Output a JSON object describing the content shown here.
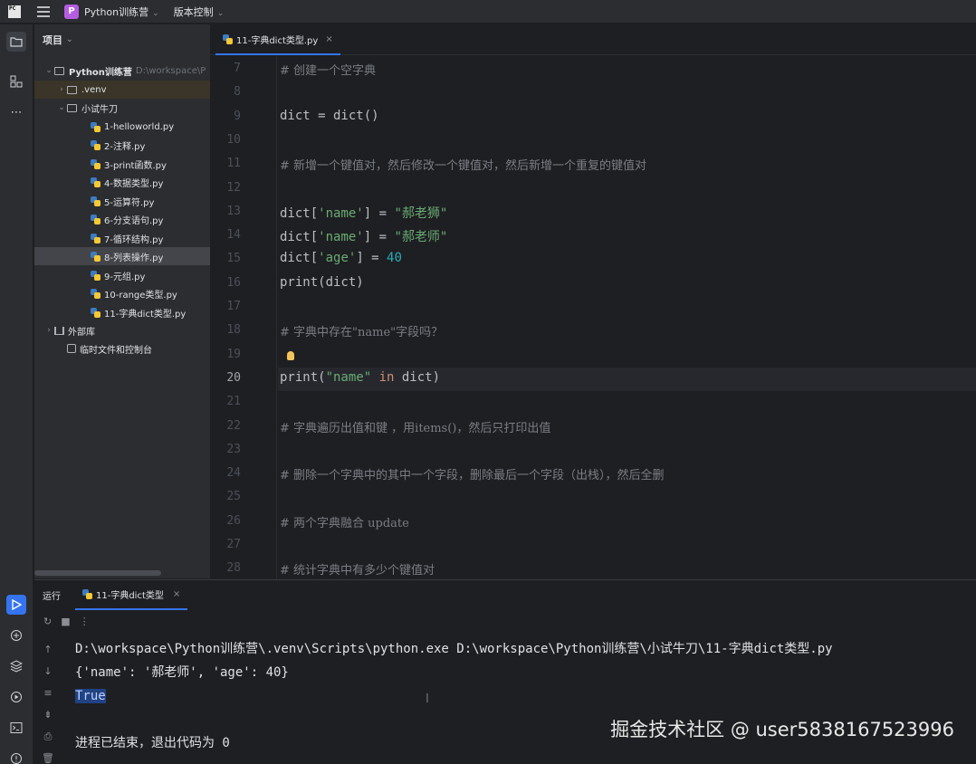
{
  "titlebar": {
    "logo": "PC",
    "project_badge": "P",
    "project_name": "Python训练营",
    "vcs": "版本控制"
  },
  "project_panel": {
    "header": "项目",
    "tree": [
      {
        "label": "Python训练营",
        "suffix": "D:\\workspace\\P",
        "icon": "folder-icon",
        "arrow": "⌄"
      },
      {
        "label": ".venv",
        "icon": "folder-icon",
        "arrow": "›"
      },
      {
        "label": "小试牛刀",
        "icon": "folder-icon",
        "arrow": "⌄"
      },
      {
        "label": "1-helloworld.py",
        "icon": "python-file-icon"
      },
      {
        "label": "2-注释.py",
        "icon": "python-file-icon"
      },
      {
        "label": "3-print函数.py",
        "icon": "python-file-icon"
      },
      {
        "label": "4-数据类型.py",
        "icon": "python-file-icon"
      },
      {
        "label": "5-运算符.py",
        "icon": "python-file-icon"
      },
      {
        "label": "6-分支语句.py",
        "icon": "python-file-icon"
      },
      {
        "label": "7-循环结构.py",
        "icon": "python-file-icon"
      },
      {
        "label": "8-列表操作.py",
        "icon": "python-file-icon"
      },
      {
        "label": "9-元组.py",
        "icon": "python-file-icon"
      },
      {
        "label": "10-range类型.py",
        "icon": "python-file-icon"
      },
      {
        "label": "11-字典dict类型.py",
        "icon": "python-file-icon"
      },
      {
        "label": "外部库",
        "icon": "library-icon",
        "arrow": "›"
      },
      {
        "label": "临时文件和控制台",
        "icon": "scratch-icon"
      }
    ]
  },
  "editor": {
    "tab": "11-字典dict类型.py",
    "current_line": "20",
    "lines": [
      {
        "n": "7",
        "code": "# 创建一个空字典"
      },
      {
        "n": "8",
        "code": ""
      },
      {
        "n": "9",
        "code": "dict = dict()"
      },
      {
        "n": "10",
        "code": ""
      },
      {
        "n": "11",
        "code": "# 新增一个键值对，然后修改一个键值对，然后新增一个重复的键值对"
      },
      {
        "n": "12",
        "code": ""
      },
      {
        "n": "13",
        "code": "dict['name'] = \"郝老狮\""
      },
      {
        "n": "14",
        "code": "dict['name'] = \"郝老师\""
      },
      {
        "n": "15",
        "code": "dict['age'] = 40"
      },
      {
        "n": "16",
        "code": "print(dict)"
      },
      {
        "n": "17",
        "code": ""
      },
      {
        "n": "18",
        "code": "# 字典中存在\"name\"字段吗？"
      },
      {
        "n": "19",
        "code": ""
      },
      {
        "n": "20",
        "code": "print(\"name\" in dict)"
      },
      {
        "n": "21",
        "code": ""
      },
      {
        "n": "22",
        "code": "# 字典遍历出值和键 ，用items()，然后只打印出值"
      },
      {
        "n": "23",
        "code": ""
      },
      {
        "n": "24",
        "code": "# 删除一个字典中的其中一个字段，删除最后一个字段（出栈），然后全删"
      },
      {
        "n": "25",
        "code": ""
      },
      {
        "n": "26",
        "code": "# 两个字典融合 update"
      },
      {
        "n": "27",
        "code": ""
      },
      {
        "n": "28",
        "code": "# 统计字典中有多少个键值对"
      }
    ]
  },
  "run_panel": {
    "label": "运行",
    "tab": "11-字典dict类型",
    "console": [
      "D:\\workspace\\Python训练营\\.venv\\Scripts\\python.exe D:\\workspace\\Python训练营\\小试牛刀\\11-字典dict类型.py",
      "{'name': '郝老师', 'age': 40}",
      "True",
      "",
      "进程已结束，退出代码为 0"
    ]
  },
  "watermark": "掘金技术社区 @ user5838167523996",
  "colors": {
    "accent": "#3574f0",
    "comment": "#7a7e85",
    "string": "#6aab73",
    "number": "#2aacb8",
    "keyword": "#cf8e6d"
  }
}
